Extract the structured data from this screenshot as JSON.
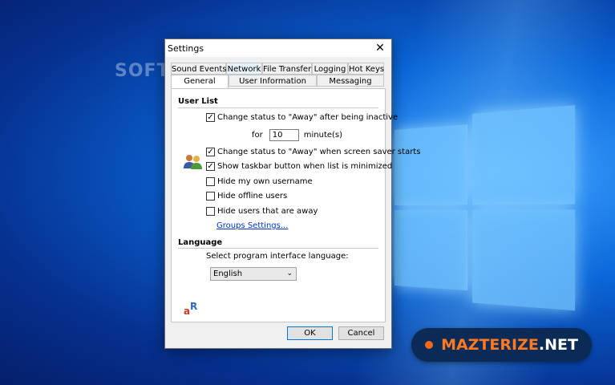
{
  "watermark": "SOFT",
  "window": {
    "title": "Settings"
  },
  "tabs_row1": [
    "Sound Events",
    "Network",
    "File Transfer",
    "Logging",
    "Hot Keys"
  ],
  "tabs_row2": [
    "General",
    "User Information",
    "Messaging"
  ],
  "user_list": {
    "heading": "User List",
    "away_inactive": {
      "label": "Change status to \"Away\" after being inactive",
      "checked": true
    },
    "for_label": "for",
    "minutes_value": "10",
    "minutes_unit": "minute(s)",
    "away_screensaver": {
      "label": "Change status to \"Away\" when screen saver starts",
      "checked": true
    },
    "taskbar": {
      "label": "Show taskbar button when list is minimized",
      "checked": true
    },
    "hide_own": {
      "label": "Hide my own username",
      "checked": false
    },
    "hide_offline": {
      "label": "Hide offline users",
      "checked": false
    },
    "hide_away": {
      "label": "Hide users that are away",
      "checked": false
    },
    "groups_link": "Groups Settings..."
  },
  "language": {
    "heading": "Language",
    "prompt": "Select program interface language:",
    "selected": "English",
    "icon_text": "aR"
  },
  "buttons": {
    "ok": "OK",
    "cancel": "Cancel"
  },
  "badge": {
    "brand": "MAZTERIZE",
    "tld": ".NET"
  }
}
